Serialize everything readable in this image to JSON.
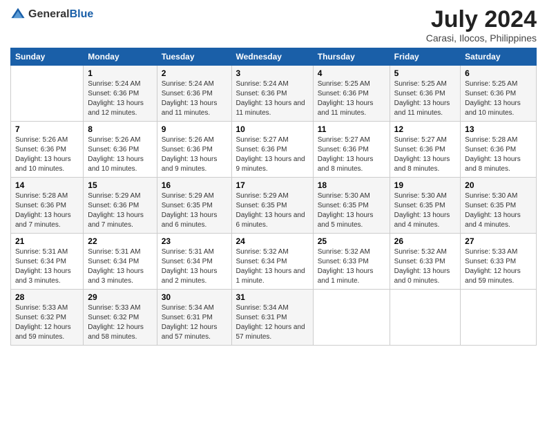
{
  "header": {
    "logo_general": "General",
    "logo_blue": "Blue",
    "title": "July 2024",
    "subtitle": "Carasi, Ilocos, Philippines"
  },
  "weekdays": [
    "Sunday",
    "Monday",
    "Tuesday",
    "Wednesday",
    "Thursday",
    "Friday",
    "Saturday"
  ],
  "weeks": [
    [
      {
        "day": "",
        "sunrise": "",
        "sunset": "",
        "daylight": ""
      },
      {
        "day": "1",
        "sunrise": "Sunrise: 5:24 AM",
        "sunset": "Sunset: 6:36 PM",
        "daylight": "Daylight: 13 hours and 12 minutes."
      },
      {
        "day": "2",
        "sunrise": "Sunrise: 5:24 AM",
        "sunset": "Sunset: 6:36 PM",
        "daylight": "Daylight: 13 hours and 11 minutes."
      },
      {
        "day": "3",
        "sunrise": "Sunrise: 5:24 AM",
        "sunset": "Sunset: 6:36 PM",
        "daylight": "Daylight: 13 hours and 11 minutes."
      },
      {
        "day": "4",
        "sunrise": "Sunrise: 5:25 AM",
        "sunset": "Sunset: 6:36 PM",
        "daylight": "Daylight: 13 hours and 11 minutes."
      },
      {
        "day": "5",
        "sunrise": "Sunrise: 5:25 AM",
        "sunset": "Sunset: 6:36 PM",
        "daylight": "Daylight: 13 hours and 11 minutes."
      },
      {
        "day": "6",
        "sunrise": "Sunrise: 5:25 AM",
        "sunset": "Sunset: 6:36 PM",
        "daylight": "Daylight: 13 hours and 10 minutes."
      }
    ],
    [
      {
        "day": "7",
        "sunrise": "Sunrise: 5:26 AM",
        "sunset": "Sunset: 6:36 PM",
        "daylight": "Daylight: 13 hours and 10 minutes."
      },
      {
        "day": "8",
        "sunrise": "Sunrise: 5:26 AM",
        "sunset": "Sunset: 6:36 PM",
        "daylight": "Daylight: 13 hours and 10 minutes."
      },
      {
        "day": "9",
        "sunrise": "Sunrise: 5:26 AM",
        "sunset": "Sunset: 6:36 PM",
        "daylight": "Daylight: 13 hours and 9 minutes."
      },
      {
        "day": "10",
        "sunrise": "Sunrise: 5:27 AM",
        "sunset": "Sunset: 6:36 PM",
        "daylight": "Daylight: 13 hours and 9 minutes."
      },
      {
        "day": "11",
        "sunrise": "Sunrise: 5:27 AM",
        "sunset": "Sunset: 6:36 PM",
        "daylight": "Daylight: 13 hours and 8 minutes."
      },
      {
        "day": "12",
        "sunrise": "Sunrise: 5:27 AM",
        "sunset": "Sunset: 6:36 PM",
        "daylight": "Daylight: 13 hours and 8 minutes."
      },
      {
        "day": "13",
        "sunrise": "Sunrise: 5:28 AM",
        "sunset": "Sunset: 6:36 PM",
        "daylight": "Daylight: 13 hours and 8 minutes."
      }
    ],
    [
      {
        "day": "14",
        "sunrise": "Sunrise: 5:28 AM",
        "sunset": "Sunset: 6:36 PM",
        "daylight": "Daylight: 13 hours and 7 minutes."
      },
      {
        "day": "15",
        "sunrise": "Sunrise: 5:29 AM",
        "sunset": "Sunset: 6:36 PM",
        "daylight": "Daylight: 13 hours and 7 minutes."
      },
      {
        "day": "16",
        "sunrise": "Sunrise: 5:29 AM",
        "sunset": "Sunset: 6:35 PM",
        "daylight": "Daylight: 13 hours and 6 minutes."
      },
      {
        "day": "17",
        "sunrise": "Sunrise: 5:29 AM",
        "sunset": "Sunset: 6:35 PM",
        "daylight": "Daylight: 13 hours and 6 minutes."
      },
      {
        "day": "18",
        "sunrise": "Sunrise: 5:30 AM",
        "sunset": "Sunset: 6:35 PM",
        "daylight": "Daylight: 13 hours and 5 minutes."
      },
      {
        "day": "19",
        "sunrise": "Sunrise: 5:30 AM",
        "sunset": "Sunset: 6:35 PM",
        "daylight": "Daylight: 13 hours and 4 minutes."
      },
      {
        "day": "20",
        "sunrise": "Sunrise: 5:30 AM",
        "sunset": "Sunset: 6:35 PM",
        "daylight": "Daylight: 13 hours and 4 minutes."
      }
    ],
    [
      {
        "day": "21",
        "sunrise": "Sunrise: 5:31 AM",
        "sunset": "Sunset: 6:34 PM",
        "daylight": "Daylight: 13 hours and 3 minutes."
      },
      {
        "day": "22",
        "sunrise": "Sunrise: 5:31 AM",
        "sunset": "Sunset: 6:34 PM",
        "daylight": "Daylight: 13 hours and 3 minutes."
      },
      {
        "day": "23",
        "sunrise": "Sunrise: 5:31 AM",
        "sunset": "Sunset: 6:34 PM",
        "daylight": "Daylight: 13 hours and 2 minutes."
      },
      {
        "day": "24",
        "sunrise": "Sunrise: 5:32 AM",
        "sunset": "Sunset: 6:34 PM",
        "daylight": "Daylight: 13 hours and 1 minute."
      },
      {
        "day": "25",
        "sunrise": "Sunrise: 5:32 AM",
        "sunset": "Sunset: 6:33 PM",
        "daylight": "Daylight: 13 hours and 1 minute."
      },
      {
        "day": "26",
        "sunrise": "Sunrise: 5:32 AM",
        "sunset": "Sunset: 6:33 PM",
        "daylight": "Daylight: 13 hours and 0 minutes."
      },
      {
        "day": "27",
        "sunrise": "Sunrise: 5:33 AM",
        "sunset": "Sunset: 6:33 PM",
        "daylight": "Daylight: 12 hours and 59 minutes."
      }
    ],
    [
      {
        "day": "28",
        "sunrise": "Sunrise: 5:33 AM",
        "sunset": "Sunset: 6:32 PM",
        "daylight": "Daylight: 12 hours and 59 minutes."
      },
      {
        "day": "29",
        "sunrise": "Sunrise: 5:33 AM",
        "sunset": "Sunset: 6:32 PM",
        "daylight": "Daylight: 12 hours and 58 minutes."
      },
      {
        "day": "30",
        "sunrise": "Sunrise: 5:34 AM",
        "sunset": "Sunset: 6:31 PM",
        "daylight": "Daylight: 12 hours and 57 minutes."
      },
      {
        "day": "31",
        "sunrise": "Sunrise: 5:34 AM",
        "sunset": "Sunset: 6:31 PM",
        "daylight": "Daylight: 12 hours and 57 minutes."
      },
      {
        "day": "",
        "sunrise": "",
        "sunset": "",
        "daylight": ""
      },
      {
        "day": "",
        "sunrise": "",
        "sunset": "",
        "daylight": ""
      },
      {
        "day": "",
        "sunrise": "",
        "sunset": "",
        "daylight": ""
      }
    ]
  ]
}
